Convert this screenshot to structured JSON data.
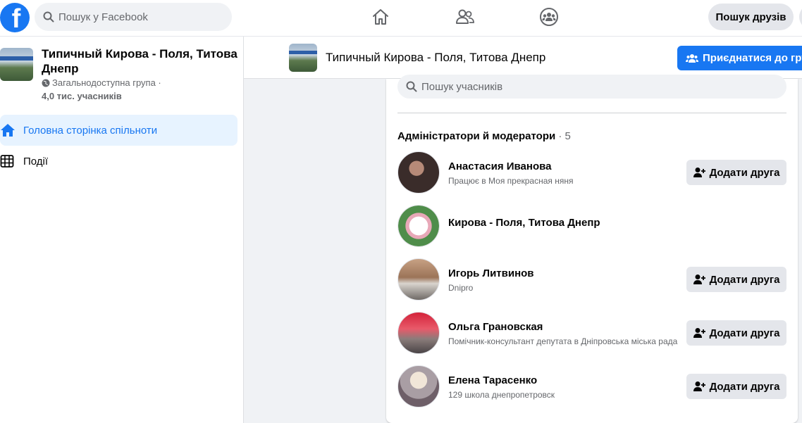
{
  "topbar": {
    "logo_letter": "f",
    "search_placeholder": "Пошук у Facebook",
    "find_friends_label": "Пошук друзів"
  },
  "sidebar": {
    "group_name": "Типичный Кирова - Поля, Титова Днепр",
    "privacy": "Загальнодоступна група ·",
    "members": "4,0 тис. учасників",
    "items": [
      {
        "label": "Головна сторінка спільноти",
        "icon": "home-icon"
      },
      {
        "label": "Події",
        "icon": "calendar-grid-icon"
      }
    ]
  },
  "header": {
    "group_title": "Типичный Кирова - Поля, Титова Днепр",
    "join_label": "Приєднатися до групи"
  },
  "members_panel": {
    "search_placeholder": "Пошук учасників",
    "section_title": "Адміністратори й модератори",
    "section_count": " · 5",
    "members": [
      {
        "name": "Анастасия Иванова",
        "subtitle": "Працює в Моя прекрасная няня",
        "add_label": "Додати друга"
      },
      {
        "name": "Кирова - Поля, Титова Днепр",
        "subtitle": "",
        "add_label": ""
      },
      {
        "name": "Игорь Литвинов",
        "subtitle": "Dnipro",
        "add_label": "Додати друга"
      },
      {
        "name": "Ольга Грановская",
        "subtitle": "Помічник-консультант депутата в Дніпровська міська рада",
        "add_label": "Додати друга"
      },
      {
        "name": "Елена Тарасенко",
        "subtitle": "129 школа днепропетровск",
        "add_label": "Додати друга"
      }
    ]
  },
  "colors": {
    "brand": "#1877f2",
    "active_bg": "#e7f3ff",
    "button_gray": "#e4e6eb",
    "page_bg": "#f0f2f5"
  }
}
